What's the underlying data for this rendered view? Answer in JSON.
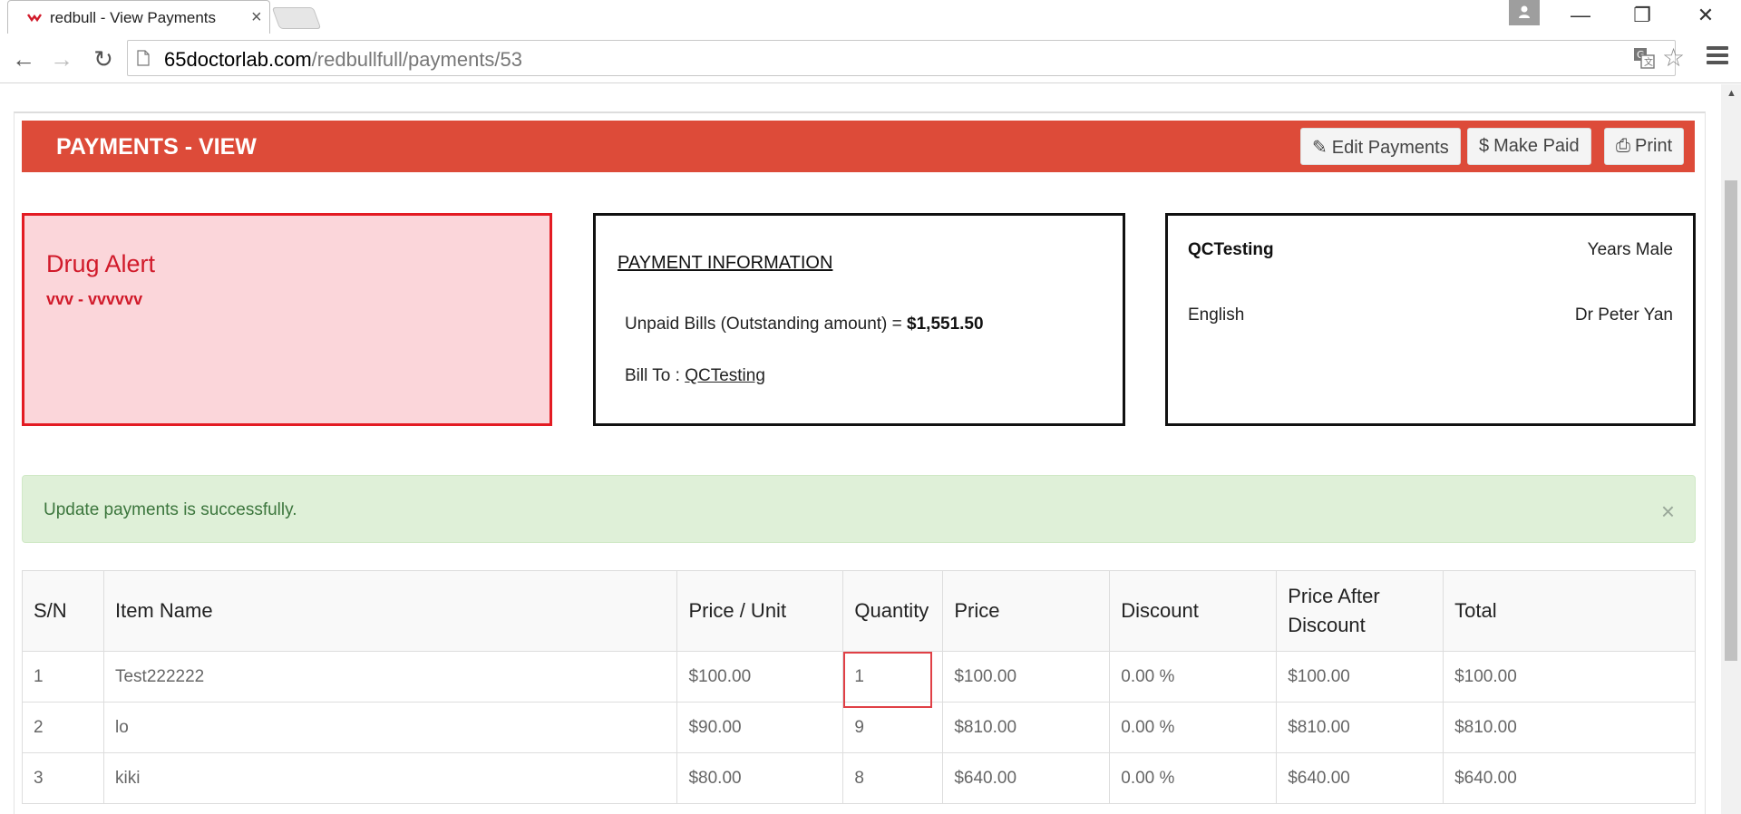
{
  "browser": {
    "tab_title": "redbull - View Payments",
    "tab_close": "×",
    "url_host": "65doctorlab.com",
    "url_path": "/redbullfull/payments/53",
    "back_glyph": "←",
    "forward_glyph": "→",
    "reload_glyph": "↻",
    "minimize_glyph": "—",
    "restore_glyph": "❐",
    "close_glyph": "✕",
    "star_glyph": "☆"
  },
  "header": {
    "title": "PAYMENTS - VIEW",
    "edit_label": "Edit Payments",
    "paid_label": "Make Paid",
    "print_label": "Print",
    "edit_icon": "✎",
    "paid_icon": "$",
    "print_icon": "⎙"
  },
  "drug_alert": {
    "title": "Drug Alert",
    "body": "vvv - vvvvvv"
  },
  "payment_info": {
    "title": "PAYMENT INFORMATION",
    "unpaid_label": "Unpaid Bills (Outstanding amount) = ",
    "unpaid_amount": "$1,551.50",
    "bill_to_label": "Bill To : ",
    "bill_to_name": "QCTesting"
  },
  "patient": {
    "name": "QCTesting",
    "age_gender": "Years Male",
    "language": "English",
    "doctor": "Dr Peter Yan"
  },
  "notice": {
    "text": "Update payments is successfully.",
    "close": "×"
  },
  "table": {
    "headers": [
      "S/N",
      "Item Name",
      "Price / Unit",
      "Quantity",
      "Price",
      "Discount",
      "Price After Discount",
      "Total"
    ],
    "rows": [
      [
        "1",
        "Test222222",
        "$100.00",
        "1",
        "$100.00",
        "0.00 %",
        "$100.00",
        "$100.00"
      ],
      [
        "2",
        "lo",
        "$90.00",
        "9",
        "$810.00",
        "0.00 %",
        "$810.00",
        "$810.00"
      ],
      [
        "3",
        "kiki",
        "$80.00",
        "8",
        "$640.00",
        "0.00 %",
        "$640.00",
        "$640.00"
      ]
    ]
  },
  "colors": {
    "header_bg": "#dd4b39",
    "alert_bg": "#fbd6da",
    "alert_border": "#e31b23",
    "success_bg": "#dff0d8",
    "success_text": "#3c763d"
  }
}
